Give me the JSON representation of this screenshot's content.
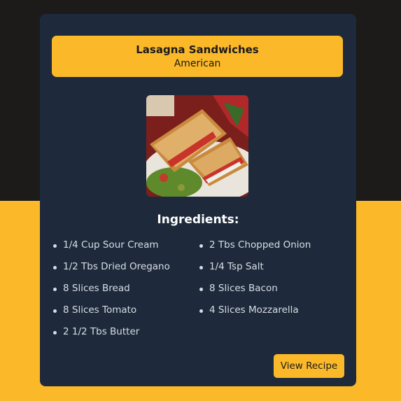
{
  "recipe": {
    "title": "Lasagna Sandwiches",
    "cuisine": "American",
    "ingredients_heading": "Ingredients:",
    "ingredients": [
      "1/4 Cup Sour Cream",
      "2 Tbs Chopped Onion",
      "1/2 Tbs Dried Oregano",
      "1/4 Tsp Salt",
      "8 Slices Bread",
      "8 Slices Bacon",
      "8 Slices Tomato",
      "4 Slices Mozzarella",
      "2 1/2 Tbs Butter"
    ],
    "button_label": "View Recipe"
  },
  "colors": {
    "accent": "#fbb92a",
    "card": "#1e2a3b",
    "page_top": "#1d1a1a"
  }
}
